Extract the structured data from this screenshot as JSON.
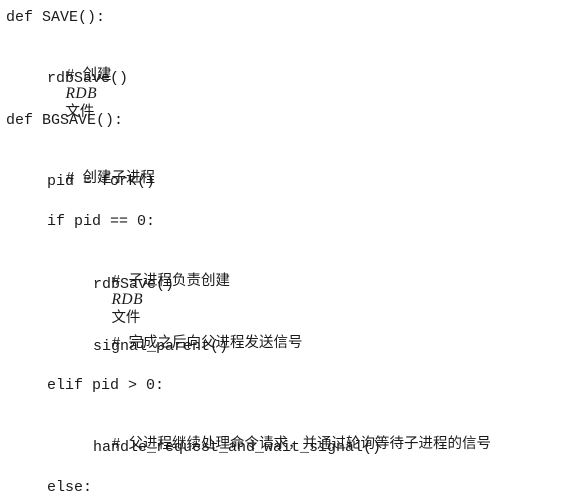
{
  "code": {
    "save_def": "def SAVE():",
    "save_comment_prefix": "#",
    "save_comment_cn1": "创建",
    "save_comment_latin": "RDB",
    "save_comment_cn2": "文件",
    "save_call": "rdbSave()",
    "bgsave_def": "def BGSAVE():",
    "fork_comment_prefix": "#",
    "fork_comment": "创建子进程",
    "fork_line": "pid = fork()",
    "if_line": "if pid == 0:",
    "child_comment_prefix": "#",
    "child_comment_cn1": "子进程负责创建",
    "child_comment_latin": "RDB",
    "child_comment_cn2": "文件",
    "child_call": "rdbSave()",
    "signal_comment_prefix": "#",
    "signal_comment": "完成之后向父进程发送信号",
    "signal_call": "signal_parent()",
    "elif_line": "elif pid > 0:",
    "parent_comment_prefix": "#",
    "parent_comment": "父进程继续处理命令请求，并通过轮询等待子进程的信号",
    "parent_call": "handle_request_and_wait_signal()",
    "else_line": "else:"
  }
}
